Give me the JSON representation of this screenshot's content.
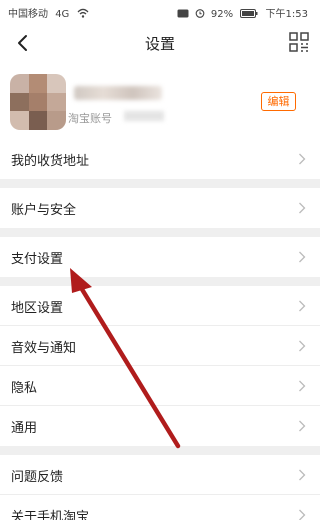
{
  "status_bar": {
    "carrier": "中国移动",
    "network": "4G",
    "battery": "92%",
    "time": "下午1:53"
  },
  "nav": {
    "title": "设置",
    "back_icon": "back-arrow-icon",
    "scan_icon": "scan-grid-icon"
  },
  "profile": {
    "account_label": "淘宝账号",
    "edit_label": "编辑"
  },
  "groups": [
    {
      "items": [
        {
          "label": "我的收货地址"
        }
      ]
    },
    {
      "items": [
        {
          "label": "账户与安全"
        }
      ]
    },
    {
      "items": [
        {
          "label": "支付设置"
        }
      ]
    },
    {
      "items": [
        {
          "label": "地区设置"
        },
        {
          "label": "音效与通知"
        },
        {
          "label": "隐私"
        },
        {
          "label": "通用"
        }
      ]
    },
    {
      "items": [
        {
          "label": "问题反馈"
        },
        {
          "label": "关于手机淘宝"
        }
      ]
    }
  ],
  "colors": {
    "accent": "#ff6a00",
    "annotation_arrow": "#b01c1c",
    "background": "#efefef"
  }
}
